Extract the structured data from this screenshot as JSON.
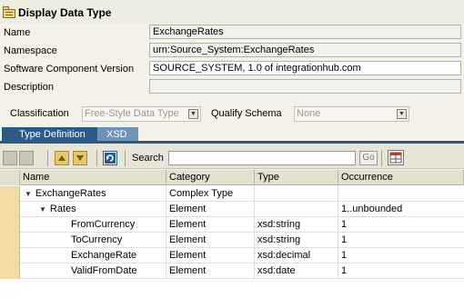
{
  "header": {
    "title": "Display Data Type"
  },
  "form": {
    "name_label": "Name",
    "name_value": "ExchangeRates",
    "namespace_label": "Namespace",
    "namespace_value": "urn:Source_System:ExchangeRates",
    "swcv_label": "Software Component Version",
    "swcv_value": "SOURCE_SYSTEM, 1.0 of integrationhub.com",
    "description_label": "Description",
    "description_value": ""
  },
  "classification": {
    "label": "Classification",
    "value": "Free-Style Data Type",
    "qualify_label": "Qualify Schema",
    "qualify_value": "None"
  },
  "tabs": [
    {
      "label": "Type Definition"
    },
    {
      "label": "XSD"
    }
  ],
  "toolbar": {
    "search_label": "Search",
    "search_value": "",
    "go_label": "Go"
  },
  "table": {
    "columns": [
      "Name",
      "Category",
      "Type",
      "Occurrence"
    ],
    "rows": [
      {
        "name": "ExchangeRates",
        "category": "Complex Type",
        "type": "",
        "occurrence": ""
      },
      {
        "name": "Rates",
        "category": "Element",
        "type": "",
        "occurrence": "1..unbounded"
      },
      {
        "name": "FromCurrency",
        "category": "Element",
        "type": "xsd:string",
        "occurrence": "1"
      },
      {
        "name": "ToCurrency",
        "category": "Element",
        "type": "xsd:string",
        "occurrence": "1"
      },
      {
        "name": "ExchangeRate",
        "category": "Element",
        "type": "xsd:decimal",
        "occurrence": "1"
      },
      {
        "name": "ValidFromDate",
        "category": "Element",
        "type": "xsd:date",
        "occurrence": "1"
      }
    ]
  },
  "colors": {
    "tab_active": "#2c5b88",
    "tab_inactive": "#6f93b7",
    "row_selector": "#f2dca3"
  }
}
